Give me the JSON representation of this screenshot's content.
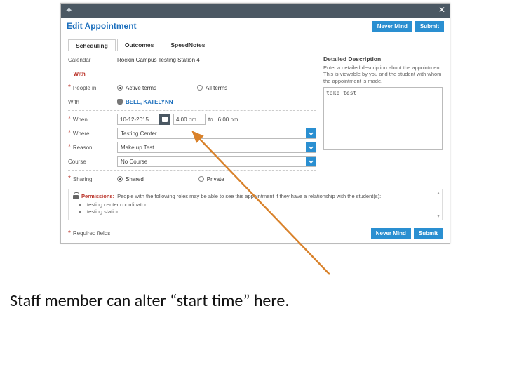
{
  "titlebar": {
    "star_icon": "star",
    "close_icon": "close"
  },
  "header": {
    "title": "Edit Appointment",
    "nevermind_label": "Never Mind",
    "submit_label": "Submit"
  },
  "tabs": {
    "scheduling": "Scheduling",
    "outcomes": "Outcomes",
    "speednotes": "SpeedNotes"
  },
  "form": {
    "calendar_label": "Calendar",
    "calendar_value": "Rockin Campus Testing Station 4",
    "with_section": "With",
    "people_in_label": "People in",
    "active_terms": "Active terms",
    "all_terms": "All terms",
    "with_label": "With",
    "with_name": "BELL, KATELYNN",
    "when_label": "When",
    "when_date": "10-12-2015",
    "when_start": "4:00 pm",
    "to": "to",
    "when_end": "6:00 pm",
    "where_label": "Where",
    "where_value": "Testing Center",
    "reason_label": "Reason",
    "reason_value": "Make up Test",
    "course_label": "Course",
    "course_value": "No Course",
    "sharing_label": "Sharing",
    "shared": "Shared",
    "private": "Private"
  },
  "side": {
    "title": "Detailed Description",
    "desc": "Enter a detailed description about the appointment. This is viewable by you and the student with whom the appointment is made.",
    "textarea_value": "take test"
  },
  "perm": {
    "title": "Permissions:",
    "text": "People with the following roles may be able to see this appointment if they have a relationship with the student(s):",
    "items": [
      "testing center coordinator",
      "testing station"
    ]
  },
  "footer": {
    "required": "Required fields",
    "nevermind_label": "Never Mind",
    "submit_label": "Submit"
  },
  "annotation": {
    "caption": "Staff member can alter “start time” here."
  }
}
